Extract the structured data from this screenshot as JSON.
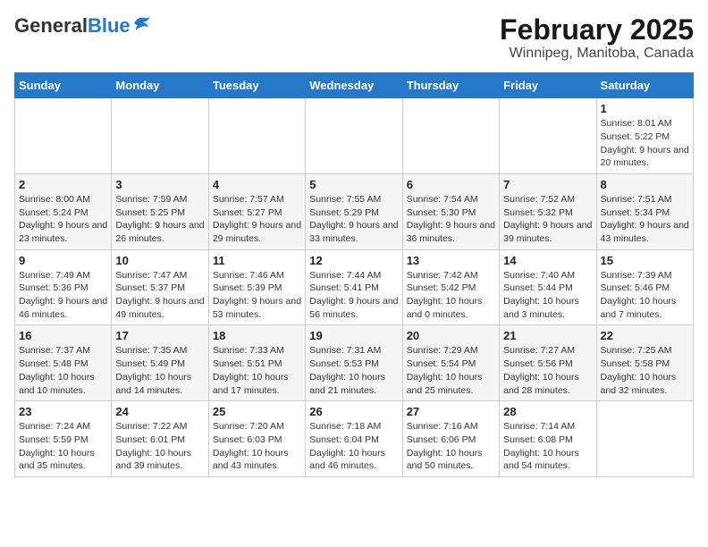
{
  "logo": {
    "general": "General",
    "blue": "Blue"
  },
  "title": "February 2025",
  "subtitle": "Winnipeg, Manitoba, Canada",
  "days_of_week": [
    "Sunday",
    "Monday",
    "Tuesday",
    "Wednesday",
    "Thursday",
    "Friday",
    "Saturday"
  ],
  "weeks": [
    [
      {
        "day": "",
        "info": ""
      },
      {
        "day": "",
        "info": ""
      },
      {
        "day": "",
        "info": ""
      },
      {
        "day": "",
        "info": ""
      },
      {
        "day": "",
        "info": ""
      },
      {
        "day": "",
        "info": ""
      },
      {
        "day": "1",
        "info": "Sunrise: 8:01 AM\nSunset: 5:22 PM\nDaylight: 9 hours and 20 minutes."
      }
    ],
    [
      {
        "day": "2",
        "info": "Sunrise: 8:00 AM\nSunset: 5:24 PM\nDaylight: 9 hours and 23 minutes."
      },
      {
        "day": "3",
        "info": "Sunrise: 7:59 AM\nSunset: 5:25 PM\nDaylight: 9 hours and 26 minutes."
      },
      {
        "day": "4",
        "info": "Sunrise: 7:57 AM\nSunset: 5:27 PM\nDaylight: 9 hours and 29 minutes."
      },
      {
        "day": "5",
        "info": "Sunrise: 7:55 AM\nSunset: 5:29 PM\nDaylight: 9 hours and 33 minutes."
      },
      {
        "day": "6",
        "info": "Sunrise: 7:54 AM\nSunset: 5:30 PM\nDaylight: 9 hours and 36 minutes."
      },
      {
        "day": "7",
        "info": "Sunrise: 7:52 AM\nSunset: 5:32 PM\nDaylight: 9 hours and 39 minutes."
      },
      {
        "day": "8",
        "info": "Sunrise: 7:51 AM\nSunset: 5:34 PM\nDaylight: 9 hours and 43 minutes."
      }
    ],
    [
      {
        "day": "9",
        "info": "Sunrise: 7:49 AM\nSunset: 5:36 PM\nDaylight: 9 hours and 46 minutes."
      },
      {
        "day": "10",
        "info": "Sunrise: 7:47 AM\nSunset: 5:37 PM\nDaylight: 9 hours and 49 minutes."
      },
      {
        "day": "11",
        "info": "Sunrise: 7:46 AM\nSunset: 5:39 PM\nDaylight: 9 hours and 53 minutes."
      },
      {
        "day": "12",
        "info": "Sunrise: 7:44 AM\nSunset: 5:41 PM\nDaylight: 9 hours and 56 minutes."
      },
      {
        "day": "13",
        "info": "Sunrise: 7:42 AM\nSunset: 5:42 PM\nDaylight: 10 hours and 0 minutes."
      },
      {
        "day": "14",
        "info": "Sunrise: 7:40 AM\nSunset: 5:44 PM\nDaylight: 10 hours and 3 minutes."
      },
      {
        "day": "15",
        "info": "Sunrise: 7:39 AM\nSunset: 5:46 PM\nDaylight: 10 hours and 7 minutes."
      }
    ],
    [
      {
        "day": "16",
        "info": "Sunrise: 7:37 AM\nSunset: 5:48 PM\nDaylight: 10 hours and 10 minutes."
      },
      {
        "day": "17",
        "info": "Sunrise: 7:35 AM\nSunset: 5:49 PM\nDaylight: 10 hours and 14 minutes."
      },
      {
        "day": "18",
        "info": "Sunrise: 7:33 AM\nSunset: 5:51 PM\nDaylight: 10 hours and 17 minutes."
      },
      {
        "day": "19",
        "info": "Sunrise: 7:31 AM\nSunset: 5:53 PM\nDaylight: 10 hours and 21 minutes."
      },
      {
        "day": "20",
        "info": "Sunrise: 7:29 AM\nSunset: 5:54 PM\nDaylight: 10 hours and 25 minutes."
      },
      {
        "day": "21",
        "info": "Sunrise: 7:27 AM\nSunset: 5:56 PM\nDaylight: 10 hours and 28 minutes."
      },
      {
        "day": "22",
        "info": "Sunrise: 7:25 AM\nSunset: 5:58 PM\nDaylight: 10 hours and 32 minutes."
      }
    ],
    [
      {
        "day": "23",
        "info": "Sunrise: 7:24 AM\nSunset: 5:59 PM\nDaylight: 10 hours and 35 minutes."
      },
      {
        "day": "24",
        "info": "Sunrise: 7:22 AM\nSunset: 6:01 PM\nDaylight: 10 hours and 39 minutes."
      },
      {
        "day": "25",
        "info": "Sunrise: 7:20 AM\nSunset: 6:03 PM\nDaylight: 10 hours and 43 minutes."
      },
      {
        "day": "26",
        "info": "Sunrise: 7:18 AM\nSunset: 6:04 PM\nDaylight: 10 hours and 46 minutes."
      },
      {
        "day": "27",
        "info": "Sunrise: 7:16 AM\nSunset: 6:06 PM\nDaylight: 10 hours and 50 minutes."
      },
      {
        "day": "28",
        "info": "Sunrise: 7:14 AM\nSunset: 6:08 PM\nDaylight: 10 hours and 54 minutes."
      },
      {
        "day": "",
        "info": ""
      }
    ]
  ]
}
